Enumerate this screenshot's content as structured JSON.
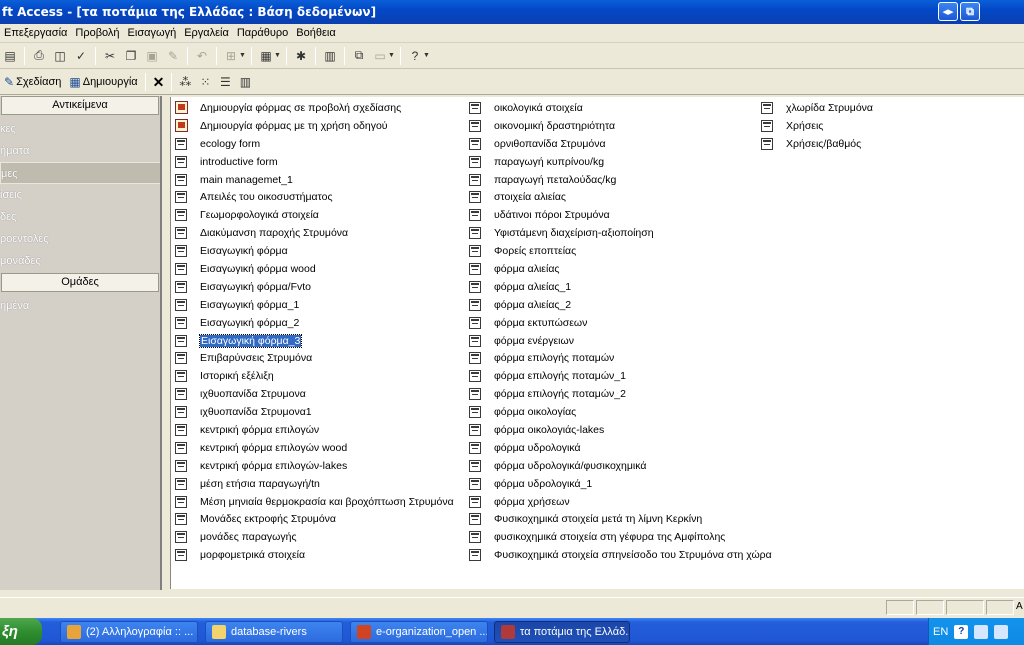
{
  "window": {
    "title": "ft Access - [τα ποτάμια της Ελλάδας : Βάση δεδομένων]",
    "restore_symbol": "◂▸",
    "close_symbol": "⧉"
  },
  "menu": [
    "Επεξεργασία",
    "Προβολή",
    "Εισαγωγή",
    "Εργαλεία",
    "Παράθυρο",
    "Βοήθεια"
  ],
  "db_toolbar": {
    "design_label": "Σχεδίαση",
    "create_label": "Δημιουργία",
    "delete_symbol": "✕"
  },
  "left_pane": {
    "objects_header": "Αντικείμενα",
    "objects": [
      "κες",
      "ήματα",
      "μες",
      "ίσεις",
      "δες",
      "ροεντολές",
      "μονάδες"
    ],
    "selected_index": 2,
    "groups_header": "Ομάδες",
    "groups": [
      "ημένα"
    ]
  },
  "forms_columns": [
    [
      {
        "label": "Δημιουργία φόρμας σε προβολή σχεδίασης",
        "icon": "wizard-icon"
      },
      {
        "label": "Δημιουργία φόρμας με τη χρήση οδηγού",
        "icon": "wizard-icon"
      },
      {
        "label": "ecology form",
        "icon": "form-icon"
      },
      {
        "label": "introductive form",
        "icon": "form-icon"
      },
      {
        "label": "main managemet_1",
        "icon": "form-icon"
      },
      {
        "label": "Απειλές του οικοσυστήματος",
        "icon": "form-icon"
      },
      {
        "label": "Γεωμορφολογικά στοιχεία",
        "icon": "form-icon"
      },
      {
        "label": "Διακύμανση παροχής Στρυμόνα",
        "icon": "form-icon"
      },
      {
        "label": "Εισαγωγική φόρμα",
        "icon": "form-icon"
      },
      {
        "label": "Εισαγωγική φόρμα wood",
        "icon": "form-icon"
      },
      {
        "label": "Εισαγωγική φόρμα/Fvto",
        "icon": "form-icon"
      },
      {
        "label": "Εισαγωγική φόρμα_1",
        "icon": "form-icon"
      },
      {
        "label": "Εισαγωγική φόρμα_2",
        "icon": "form-icon"
      },
      {
        "label": "Εισαγωγική φόρμα_3",
        "icon": "form-icon",
        "selected": true
      },
      {
        "label": "Επιβαρύνσεις Στρυμόνα",
        "icon": "form-icon"
      },
      {
        "label": "Ιστορική εξέλιξη",
        "icon": "form-icon"
      },
      {
        "label": "ιχθυοπανίδα Στρυμονα",
        "icon": "form-icon"
      },
      {
        "label": "ιχθυοπανίδα Στρυμονα1",
        "icon": "form-icon"
      },
      {
        "label": "κεντρική φόρμα επιλογών",
        "icon": "form-icon"
      },
      {
        "label": "κεντρική φόρμα επιλογών wood",
        "icon": "form-icon"
      },
      {
        "label": "κεντρική φόρμα επιλογών-lakes",
        "icon": "form-icon"
      },
      {
        "label": "μέση ετήσια παραγωγή/tn",
        "icon": "form-icon"
      },
      {
        "label": "Μέση μηνιαία θερμοκρασία και βροχόπτωση Στρυμόνα",
        "icon": "form-icon"
      },
      {
        "label": "Μονάδες εκτροφής Στρυμόνα",
        "icon": "form-icon"
      },
      {
        "label": "μονάδες παραγωγής",
        "icon": "form-icon"
      },
      {
        "label": "μορφομετρικά στοιχεία",
        "icon": "form-icon"
      }
    ],
    [
      {
        "label": "οικολογικά στοιχεία",
        "icon": "form-icon"
      },
      {
        "label": "οικονομική δραστηριότητα",
        "icon": "form-icon"
      },
      {
        "label": "ορνιθοπανίδα Στρυμόνα",
        "icon": "form-icon"
      },
      {
        "label": "παραγωγή κυπρίνου/kg",
        "icon": "form-icon"
      },
      {
        "label": "παραγωγή πεταλούδας/kg",
        "icon": "form-icon"
      },
      {
        "label": "στοιχεία αλιείας",
        "icon": "form-icon"
      },
      {
        "label": "υδάτινοι πόροι Στρυμόνα",
        "icon": "form-icon"
      },
      {
        "label": "Υφιστάμενη διαχείριση-αξιοποίηση",
        "icon": "form-icon"
      },
      {
        "label": "Φορείς εποπτείας",
        "icon": "form-icon"
      },
      {
        "label": "φόρμα αλιείας",
        "icon": "form-icon"
      },
      {
        "label": "φόρμα αλιείας_1",
        "icon": "form-icon"
      },
      {
        "label": "φόρμα αλιείας_2",
        "icon": "form-icon"
      },
      {
        "label": "φόρμα εκτυπώσεων",
        "icon": "form-icon"
      },
      {
        "label": "φόρμα ενέργειων",
        "icon": "form-icon"
      },
      {
        "label": "φόρμα επιλογής ποταμών",
        "icon": "form-icon"
      },
      {
        "label": "φόρμα επιλογής ποταμών_1",
        "icon": "form-icon"
      },
      {
        "label": "φόρμα επιλογής ποταμών_2",
        "icon": "form-icon"
      },
      {
        "label": "φόρμα οικολογίας",
        "icon": "form-icon"
      },
      {
        "label": "φόρμα οικολογιάς-lakes",
        "icon": "form-icon"
      },
      {
        "label": "φόρμα υδρολογικά",
        "icon": "form-icon"
      },
      {
        "label": "φόρμα υδρολογικά/φυσικοχημικά",
        "icon": "form-icon"
      },
      {
        "label": "φόρμα υδρολογικά_1",
        "icon": "form-icon"
      },
      {
        "label": "φόρμα χρήσεων",
        "icon": "form-icon"
      },
      {
        "label": "Φυσικοχημικά στοιχεία μετά τη λίμνη Κερκίνη",
        "icon": "form-icon"
      },
      {
        "label": "φυσικοχημικά στοιχεία στη γέφυρα της Αμφίπολης",
        "icon": "form-icon"
      },
      {
        "label": "Φυσικοχημικά στοιχεία σπηνείσοδο του Στρυμόνα στη χώρα",
        "icon": "form-icon"
      }
    ],
    [
      {
        "label": "χλωρίδα Στρυμόνα",
        "icon": "form-icon"
      },
      {
        "label": "Χρήσεις",
        "icon": "form-icon"
      },
      {
        "label": "Χρήσεις/βαθμός",
        "icon": "form-icon"
      }
    ]
  ],
  "status_bar": {
    "right_text": "A"
  },
  "taskbar": {
    "start_label": "ξη",
    "tasks": [
      {
        "label": "(2) Αλληλογραφία :: ...",
        "icon": "chrome-icon",
        "color": "#e8a33b"
      },
      {
        "label": "database-rivers",
        "icon": "folder-icon",
        "color": "#f3d36b"
      },
      {
        "label": "e-organization_open ...",
        "icon": "powerpoint-icon",
        "color": "#d04423"
      },
      {
        "label": "τα ποτάμια της Ελλάδ...",
        "icon": "access-icon",
        "color": "#b03a3a",
        "active": true
      }
    ],
    "tray": {
      "lang": "EN",
      "help": "?"
    }
  }
}
